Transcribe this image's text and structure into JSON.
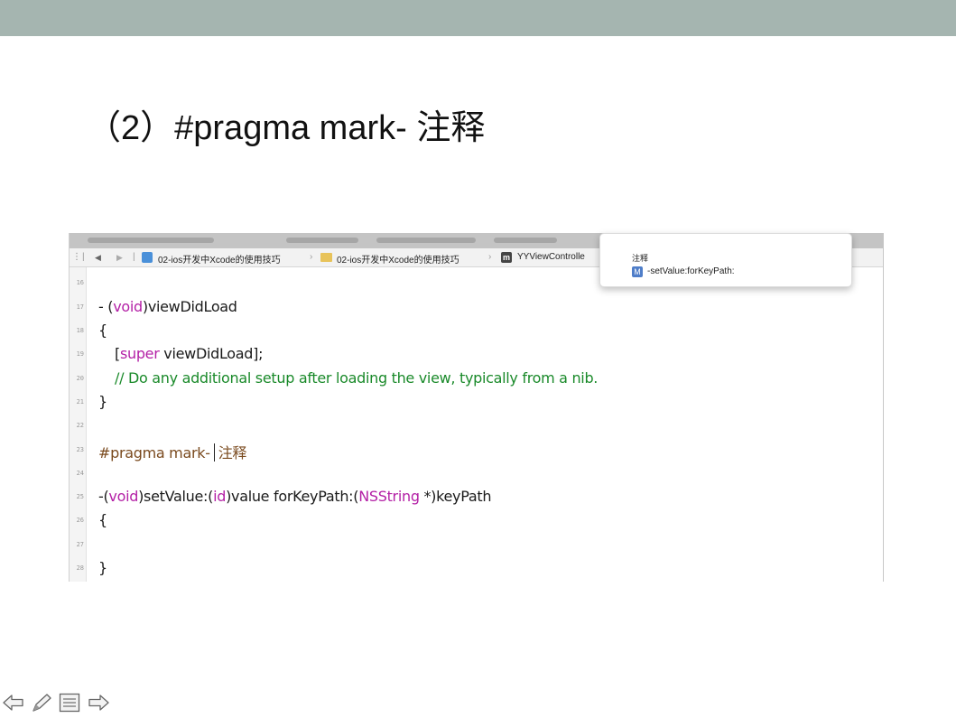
{
  "slide": {
    "title": "（2）#pragma mark- 注释"
  },
  "colors": {
    "top_band": "#a5b5b0",
    "keyword": "#b421a6",
    "comment": "#1a8a2a",
    "pragma": "#7a4a1e",
    "symbol_badge": "#4f7ec9"
  },
  "editor": {
    "jumpbar": {
      "back_icon": "back-arrow-icon",
      "forward_icon": "forward-arrow-icon",
      "project": "02-ios开发中Xcode的使用技巧",
      "group": "02-ios开发中Xcode的使用技巧",
      "file_badge": "m",
      "file": "YYViewControlle"
    },
    "popover": {
      "heading": "注释",
      "badge": "M",
      "symbol": "-setValue:forKeyPath:"
    },
    "lines": [
      {
        "num": "16"
      },
      {
        "num": "17",
        "tokens": [
          "- (",
          "void",
          ")viewDidLoad"
        ]
      },
      {
        "num": "18",
        "tokens": [
          "{"
        ]
      },
      {
        "num": "19",
        "tokens": [
          "[",
          "super",
          " viewDidLoad];"
        ]
      },
      {
        "num": "20",
        "tokens": [
          "// Do any additional setup after loading the view, typically from a nib."
        ]
      },
      {
        "num": "21",
        "tokens": [
          "}"
        ]
      },
      {
        "num": "22"
      },
      {
        "num": "23",
        "tokens": [
          "#pragma mark-",
          "注释"
        ]
      },
      {
        "num": "24"
      },
      {
        "num": "25",
        "tokens": [
          "-(",
          "void",
          ")setValue:(",
          "id",
          ")value forKeyPath:(",
          "NSString",
          " *)keyPath"
        ]
      },
      {
        "num": "26",
        "tokens": [
          "{"
        ]
      },
      {
        "num": "27"
      },
      {
        "num": "28",
        "tokens": [
          "}"
        ]
      }
    ]
  },
  "nav": [
    {
      "icon": "previous-slide-arrow-icon"
    },
    {
      "icon": "pen-icon"
    },
    {
      "icon": "menu-icon"
    },
    {
      "icon": "next-slide-arrow-icon"
    }
  ]
}
